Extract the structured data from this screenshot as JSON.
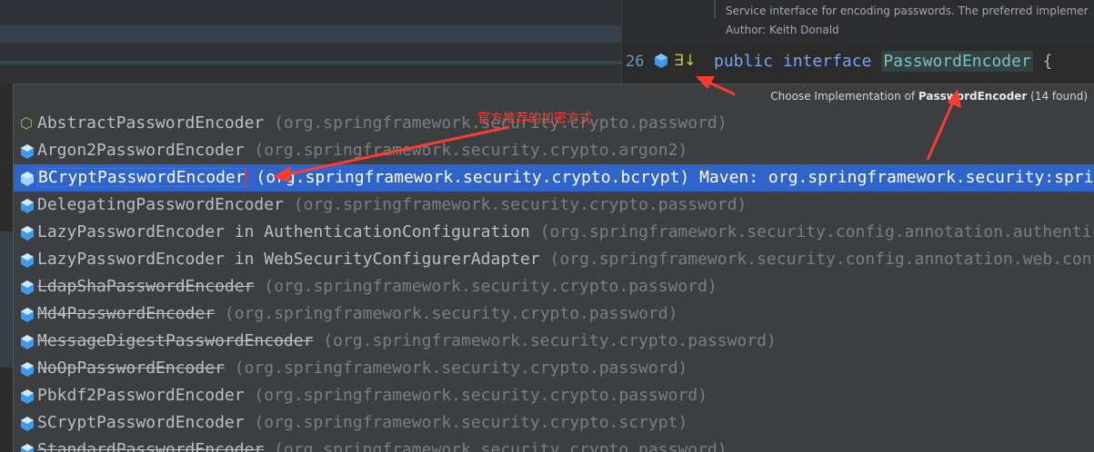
{
  "javadoc": {
    "line1": "Service interface for encoding passwords. The preferred implemer",
    "line2": "Author: Keith Donald"
  },
  "editor": {
    "line_number": "26",
    "code_keyword_public": "public",
    "code_keyword_interface": "interface",
    "code_type": "PasswordEncoder",
    "code_brace": " {",
    "gutter_impl_glyph": "∃↓"
  },
  "chooser": {
    "title_prefix": "Choose Implementation of ",
    "title_type": "PasswordEncoder",
    "title_count": " (14 found)",
    "items": [
      {
        "name": "AbstractPasswordEncoder",
        "pkg": " (org.springframework.security.crypto.password)"
      },
      {
        "name": "Argon2PasswordEncoder",
        "pkg": " (org.springframework.security.crypto.argon2)"
      },
      {
        "name": "BCryptPasswordEncoder",
        "pkg": " (org.springframework.security.crypto.bcrypt)  Maven: org.springframework.security:spring-security-crypto"
      },
      {
        "name": "DelegatingPasswordEncoder",
        "pkg": " (org.springframework.security.crypto.password)"
      },
      {
        "name": "LazyPasswordEncoder in AuthenticationConfiguration",
        "pkg": " (org.springframework.security.config.annotation.authentication.configuration)"
      },
      {
        "name": "LazyPasswordEncoder in WebSecurityConfigurerAdapter",
        "pkg": " (org.springframework.security.config.annotation.web.configuration)"
      },
      {
        "name": "LdapShaPasswordEncoder",
        "pkg": " (org.springframework.security.crypto.password)"
      },
      {
        "name": "Md4PasswordEncoder",
        "pkg": " (org.springframework.security.crypto.password)"
      },
      {
        "name": "MessageDigestPasswordEncoder",
        "pkg": " (org.springframework.security.crypto.password)"
      },
      {
        "name": "NoOpPasswordEncoder",
        "pkg": " (org.springframework.security.crypto.password)"
      },
      {
        "name": "Pbkdf2PasswordEncoder",
        "pkg": " (org.springframework.security.crypto.password)"
      },
      {
        "name": "SCryptPasswordEncoder",
        "pkg": " (org.springframework.security.crypto.scrypt)"
      },
      {
        "name": "StandardPasswordEncoder",
        "pkg": " (org.springframework.security.crypto.password)"
      }
    ]
  },
  "annotation": {
    "text": "官方推荐的加密方式",
    "color": "#ff3b30"
  },
  "colors": {
    "selection": "#2f65ca",
    "popup_bg": "#3c3f41",
    "package_gray": "#7d7d7d",
    "class_icon_blue": "#3d9be9"
  },
  "icons": {
    "class": "class-icon",
    "abstract_class": "abstract-class-icon",
    "implementations": "implementations-gutter-icon"
  }
}
